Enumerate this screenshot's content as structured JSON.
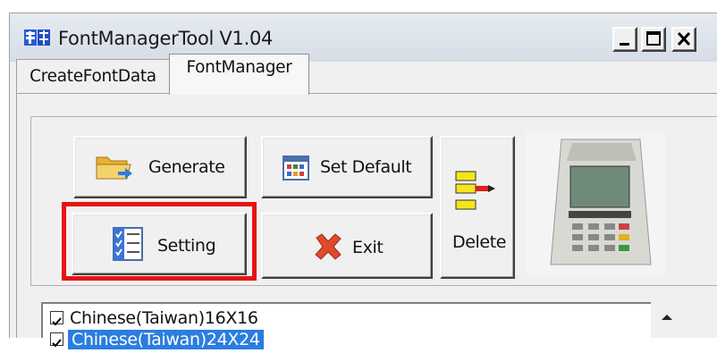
{
  "window": {
    "title": "FontManagerTool V1.04",
    "icon": "app-font-icon",
    "controls": [
      "minimize-icon",
      "maximize-icon",
      "close-icon"
    ]
  },
  "tabs": [
    {
      "label": "CreateFontData",
      "active": false
    },
    {
      "label": "FontManager",
      "active": true
    }
  ],
  "buttons": {
    "generate": {
      "label": "Generate",
      "icon": "folder-arrow-icon"
    },
    "set_default": {
      "label": "Set Default",
      "icon": "calendar-grid-icon"
    },
    "delete": {
      "label": "Delete",
      "icon": "move-entry-icon"
    },
    "setting": {
      "label": "Setting",
      "icon": "checklist-icon"
    },
    "exit": {
      "label": "Exit",
      "icon": "red-x-icon"
    }
  },
  "highlight_color": "#e81414",
  "device_image": "payment-terminal-image",
  "font_list": [
    {
      "label": "Chinese(Taiwan)16X16",
      "checked": true,
      "selected": false
    },
    {
      "label": "Chinese(Taiwan)24X24",
      "checked": true,
      "selected": true
    }
  ]
}
